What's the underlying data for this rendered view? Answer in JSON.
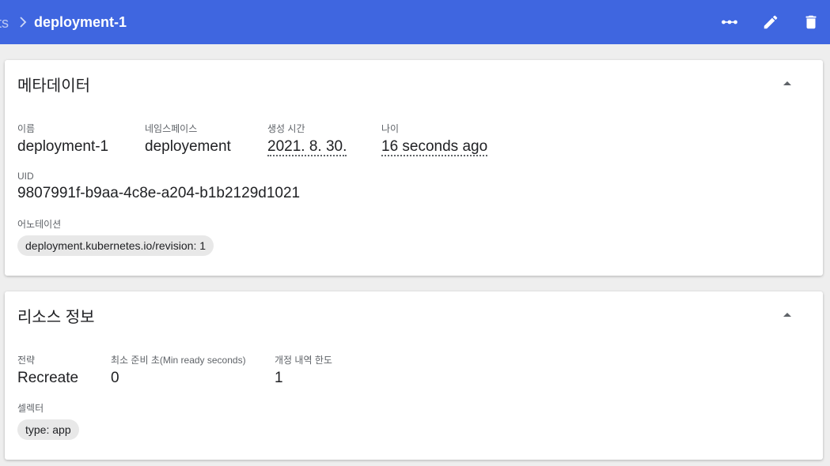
{
  "toolbar": {
    "breadcrumb_prev": "ts",
    "breadcrumb_current": "deployment-1",
    "accent": "#3f66e0"
  },
  "metadata": {
    "title": "메타데이터",
    "name_label": "이름",
    "name_value": "deployment-1",
    "namespace_label": "네임스페이스",
    "namespace_value": "deployement",
    "created_label": "생성 시간",
    "created_value": "2021. 8. 30.",
    "age_label": "나이",
    "age_value": "16 seconds ago",
    "uid_label": "UID",
    "uid_value": "9807991f-b9aa-4c8e-a204-b1b2129d1021",
    "annotations_label": "어노테이션",
    "annotations": [
      "deployment.kubernetes.io/revision: 1"
    ]
  },
  "resource": {
    "title": "리소스 정보",
    "strategy_label": "전략",
    "strategy_value": "Recreate",
    "min_ready_label": "최소 준비 초(Min ready seconds)",
    "min_ready_value": "0",
    "revision_limit_label": "개정 내역 한도",
    "revision_limit_value": "1",
    "selector_label": "셀렉터",
    "selectors": [
      "type: app"
    ]
  },
  "icons": {
    "more": "more-horizontal-icon",
    "edit": "pencil-icon",
    "delete": "trash-icon",
    "collapse": "arrow-up-icon"
  }
}
